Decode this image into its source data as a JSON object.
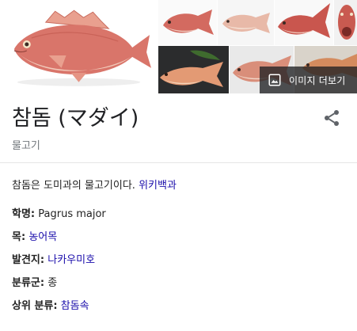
{
  "colors": {
    "link": "#1a0dab",
    "title": "#202124",
    "subtitle": "#70757a",
    "fish_body": "#d9756a",
    "fish_belly": "#f1c9b9"
  },
  "gallery": {
    "more_images_label": "이미지 더보기",
    "more_images_icon": "image-icon"
  },
  "entity": {
    "title": "참돔 (マダイ)",
    "subtitle": "물고기",
    "share_icon": "share-icon"
  },
  "description": {
    "text": "참돔은 도미과의 물고기이다. ",
    "source_link": "위키백과"
  },
  "facts": [
    {
      "key": "학명:",
      "value": "Pagrus major",
      "is_link": false
    },
    {
      "key": "목:",
      "value": "농어목",
      "is_link": true
    },
    {
      "key": "발견지:",
      "value": "나카우미호",
      "is_link": true
    },
    {
      "key": "분류군:",
      "value": "종",
      "is_link": false
    },
    {
      "key": "상위 분류:",
      "value": "참돔속",
      "is_link": true
    }
  ]
}
